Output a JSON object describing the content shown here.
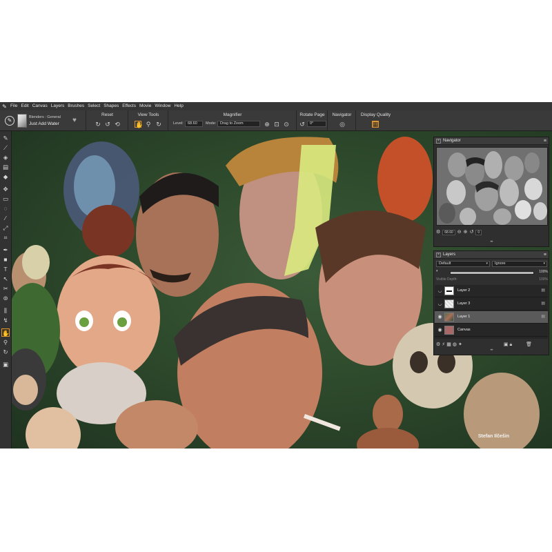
{
  "menubar": {
    "items": [
      "File",
      "Edit",
      "Canvas",
      "Layers",
      "Brushes",
      "Select",
      "Shapes",
      "Effects",
      "Movie",
      "Window",
      "Help"
    ]
  },
  "propbar": {
    "brush_category": "Blenders : General",
    "brush_name": "Just Add Water",
    "reset_title": "Reset",
    "view_tools_title": "View Tools",
    "magnifier_title": "Magnifier",
    "level_label": "Level:",
    "level_value": "68.60",
    "mode_label": "Mode:",
    "mode_value": "Drag to Zoom",
    "rotate_title": "Rotate Page",
    "rotate_value": "0°",
    "navigator_title": "Navigator",
    "display_quality_title": "Display Quality"
  },
  "navigator": {
    "title": "Navigator",
    "zoom_value": "68.60",
    "rotate_value": "0"
  },
  "layers": {
    "title": "Layers",
    "composite_method": "Default",
    "composite_depth": "Ignore",
    "opacity": 100,
    "opacity_label": "100%",
    "visible_depth_label": "Visible Depth:",
    "visible_depth_value": "100%",
    "items": [
      {
        "name": "Layer 2",
        "visible": false,
        "selected": false
      },
      {
        "name": "Layer 3",
        "visible": false,
        "selected": false
      },
      {
        "name": "Layer 1",
        "visible": true,
        "selected": true
      },
      {
        "name": "Canvas",
        "visible": true,
        "selected": false
      }
    ]
  },
  "canvas": {
    "signature": "Stefan Ilčešin"
  },
  "colors": {
    "accent_orange": "#e0962f",
    "background_green": "#2e4a2c",
    "panel_dark": "#2f2f2f"
  }
}
